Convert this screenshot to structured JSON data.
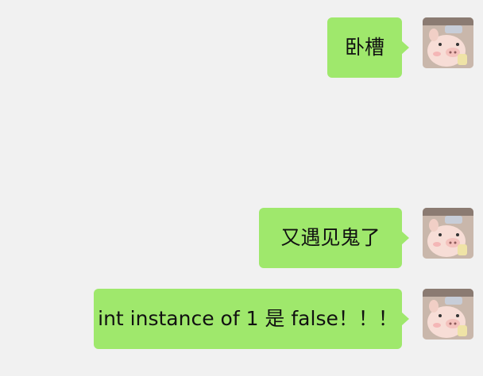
{
  "chat": {
    "messages": [
      {
        "sender": "self",
        "text": "卧槽"
      },
      {
        "sender": "self",
        "text": "又遇见鬼了"
      },
      {
        "sender": "self",
        "text": "int instance of 1 是 false！！！"
      }
    ]
  },
  "colors": {
    "background": "#f1f1f1",
    "bubble": "#9fe86c",
    "text": "#111111"
  },
  "avatar": {
    "icon": "pig-avatar-icon"
  }
}
